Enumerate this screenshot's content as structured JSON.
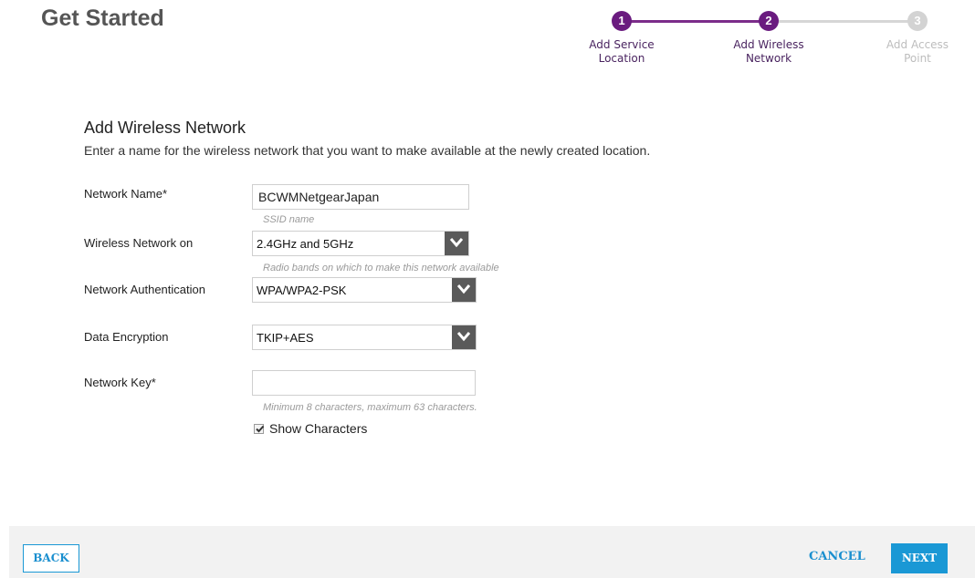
{
  "header": {
    "title": "Get Started"
  },
  "stepper": {
    "steps": [
      {
        "number": "1",
        "label_line1": "Add Service",
        "label_line2": "Location",
        "state": "done"
      },
      {
        "number": "2",
        "label_line1": "Add Wireless",
        "label_line2": "Network",
        "state": "active"
      },
      {
        "number": "3",
        "label_line1": "Add Access",
        "label_line2": "Point",
        "state": "pending"
      }
    ],
    "active_color": "#6a1b7f",
    "inactive_color": "#d3d3d3"
  },
  "section": {
    "title": "Add Wireless Network",
    "description": "Enter a name for the wireless network that you want to make available at the newly created location."
  },
  "form": {
    "network_name": {
      "label": "Network Name*",
      "value": "BCWMNetgearJapan",
      "hint": "SSID name"
    },
    "wireless_network_on": {
      "label": "Wireless Network on",
      "value": "2.4GHz and 5GHz",
      "hint": "Radio bands on which to make this network available"
    },
    "network_authentication": {
      "label": "Network Authentication",
      "value": "WPA/WPA2-PSK"
    },
    "data_encryption": {
      "label": "Data Encryption",
      "value": "TKIP+AES"
    },
    "network_key": {
      "label": "Network Key*",
      "value": "",
      "hint": "Minimum 8 characters, maximum 63 characters."
    },
    "show_characters": {
      "label": "Show Characters",
      "checked": true
    }
  },
  "footer": {
    "back_label": "BACK",
    "cancel_label": "CANCEL",
    "next_label": "NEXT",
    "accent_color": "#1a98d5"
  }
}
